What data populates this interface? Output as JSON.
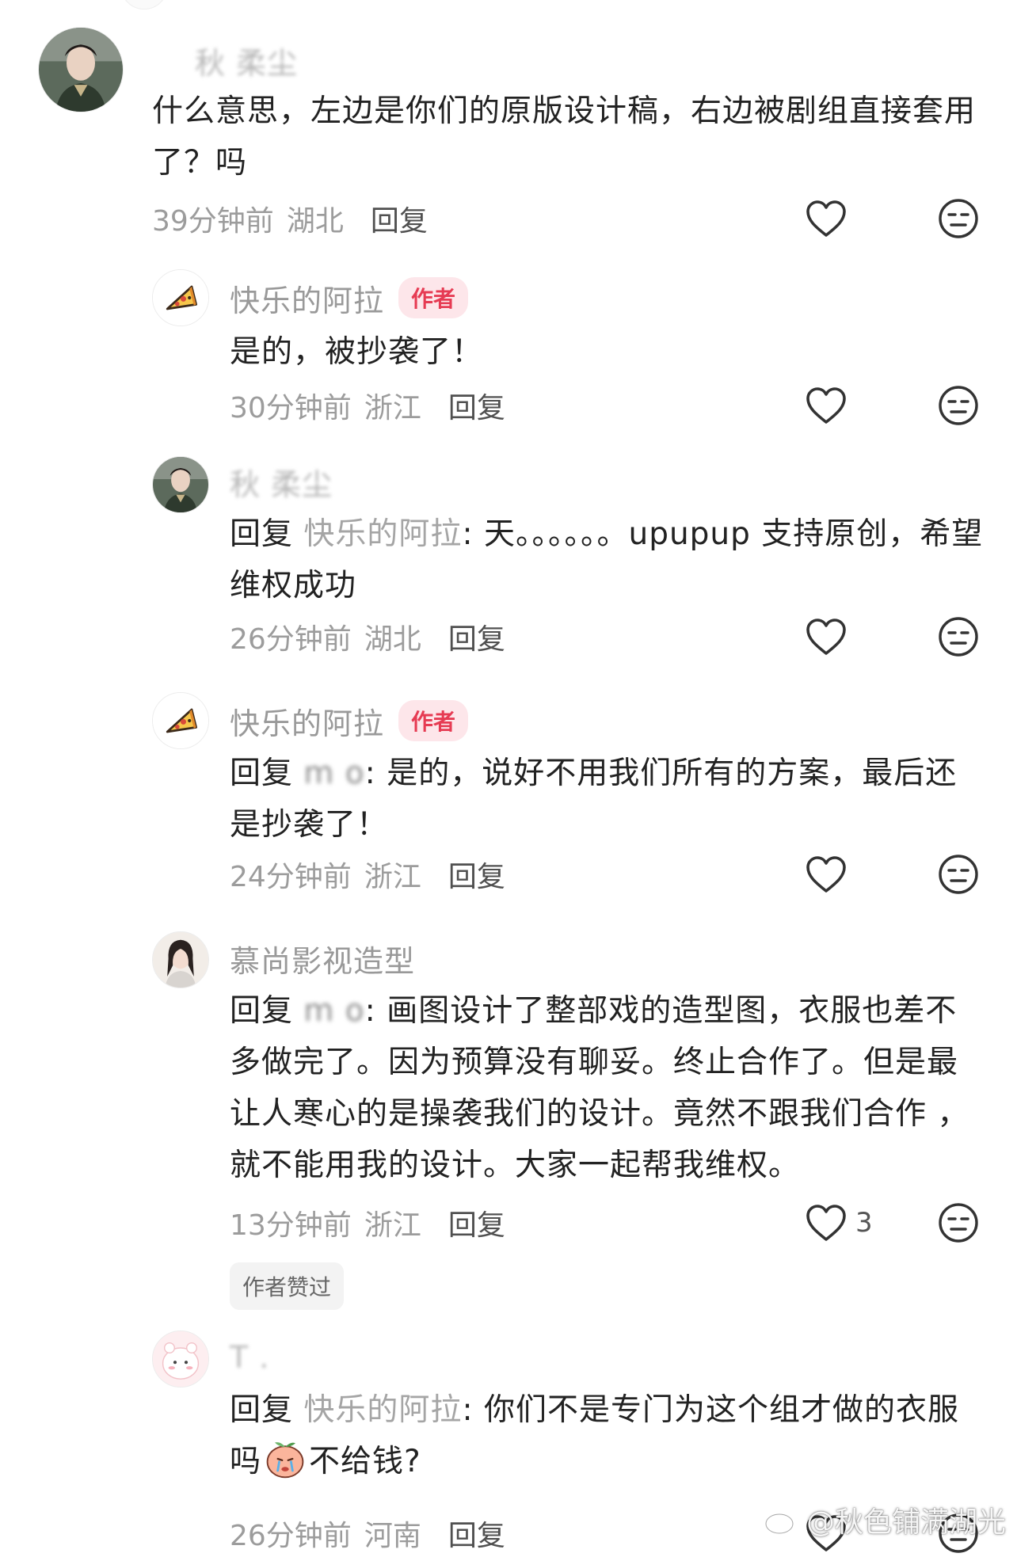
{
  "comments": [
    {
      "username": "秋  柔尘",
      "text": "什么意思，左边是你们的原版设计稿，右边被剧组直接套用了？吗",
      "time": "39分钟前",
      "region": "湖北",
      "reply_label": "回复"
    },
    {
      "username": "快乐的阿拉",
      "badge": "作者",
      "text": "是的，被抄袭了！",
      "time": "30分钟前",
      "region": "浙江",
      "reply_label": "回复"
    },
    {
      "username": "秋  柔尘",
      "reply_prefix": "回复",
      "reply_target": "快乐的阿拉",
      "text": ": 天。。。。。。upupup 支持原创，希望维权成功",
      "time": "26分钟前",
      "region": "湖北",
      "reply_label": "回复"
    },
    {
      "username": "快乐的阿拉",
      "badge": "作者",
      "reply_prefix": "回复",
      "reply_target": "m  o",
      "text": ": 是的，说好不用我们所有的方案，最后还是抄袭了！",
      "time": "24分钟前",
      "region": "浙江",
      "reply_label": "回复"
    },
    {
      "username": "慕尚影视造型",
      "reply_prefix": "回复",
      "reply_target": "m  o",
      "text": ": 画图设计了整部戏的造型图，衣服也差不多做完了。因为预算没有聊妥。终止合作了。但是最让人寒心的是操袭我们的设计。竟然不跟我们合作 ，就不能用我的设计。大家一起帮我维权。",
      "time": "13分钟前",
      "region": "浙江",
      "reply_label": "回复",
      "like_count": "3",
      "liked_by_author": "作者赞过"
    },
    {
      "username": "T  .",
      "reply_prefix": "回复",
      "reply_target": "快乐的阿拉",
      "text_before_emoji": ": 你们不是专门为这个组才做的衣服吗",
      "text_after_emoji": "不给钱?",
      "time": "26分钟前",
      "region": "河南",
      "reply_label": "回复"
    }
  ],
  "watermark": "@秋色铺满湖光",
  "colors": {
    "username": "#999999",
    "badge_bg": "#fde6ea",
    "badge_text": "#e63b53",
    "meta": "#9c9c9c"
  }
}
